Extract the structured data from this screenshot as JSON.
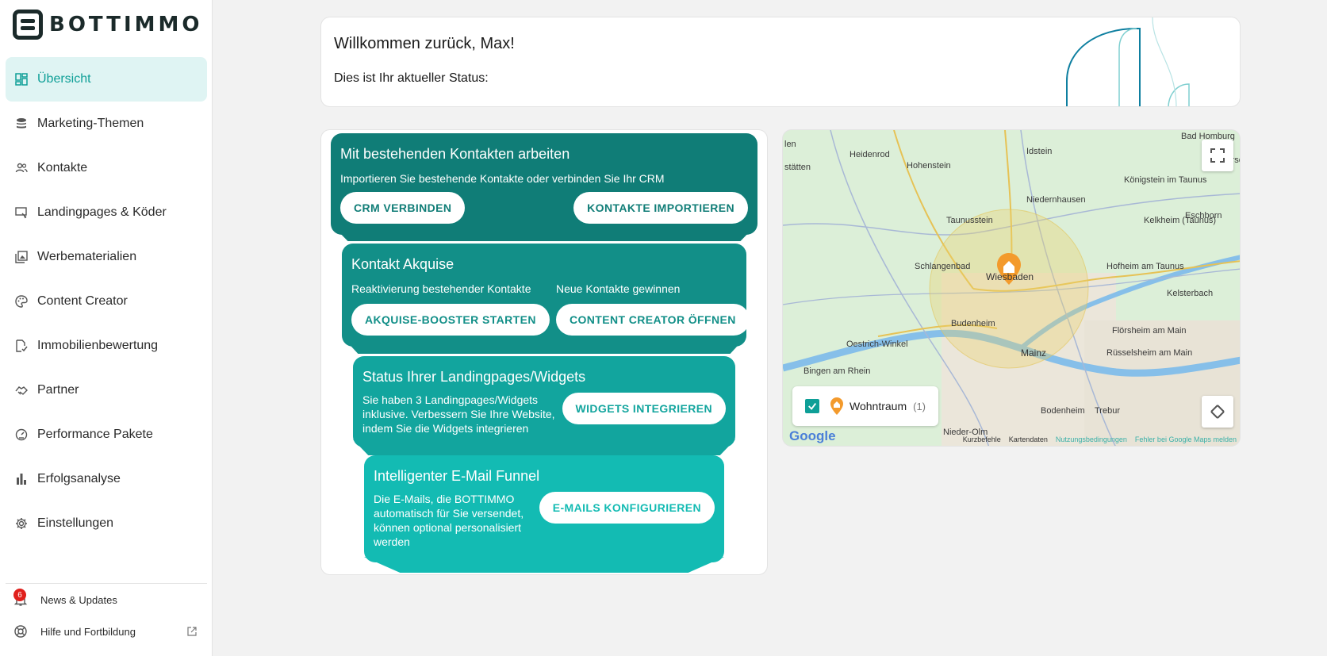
{
  "brand": {
    "name": "BOTTIMMO"
  },
  "sidebar": {
    "items": [
      {
        "label": "Übersicht",
        "icon": "dashboard-icon",
        "active": true
      },
      {
        "label": "Marketing-Themen",
        "icon": "database-icon"
      },
      {
        "label": "Kontakte",
        "icon": "people-icon"
      },
      {
        "label": "Landingpages & Köder",
        "icon": "landingpage-icon"
      },
      {
        "label": "Werbematerialien",
        "icon": "image-gallery-icon"
      },
      {
        "label": "Content Creator",
        "icon": "palette-icon"
      },
      {
        "label": "Immobilienbewertung",
        "icon": "file-check-icon"
      },
      {
        "label": "Partner",
        "icon": "handshake-icon"
      },
      {
        "label": "Performance Pakete",
        "icon": "speedometer-icon"
      },
      {
        "label": "Erfolgsanalyse",
        "icon": "bar-chart-icon"
      },
      {
        "label": "Einstellungen",
        "icon": "gear-icon"
      }
    ],
    "bottom": {
      "news_label": "News & Updates",
      "news_badge": "6",
      "help_label": "Hilfe und Fortbildung"
    }
  },
  "welcome": {
    "title": "Willkommen zurück, Max!",
    "subtitle": "Dies ist Ihr aktueller Status:"
  },
  "funnel": {
    "stage1": {
      "title": "Mit bestehenden Kontakten arbeiten",
      "text": "Importieren Sie bestehende Kontakte oder verbinden Sie Ihr CRM",
      "btn_left": "CRM VERBINDEN",
      "btn_right": "KONTAKTE IMPORTIEREN"
    },
    "stage2": {
      "title": "Kontakt Akquise",
      "text_left": "Reaktivierung bestehender Kontakte",
      "text_right": "Neue Kontakte gewinnen",
      "btn_left": "AKQUISE-BOOSTER STARTEN",
      "btn_right": "CONTENT CREATOR ÖFFNEN"
    },
    "stage3": {
      "title": "Status Ihrer Landingpages/Widgets",
      "text": "Sie haben 3 Landingpages/Widgets inklusive. Verbessern Sie Ihre Website, indem Sie die Widgets integrieren",
      "btn": "WIDGETS INTEGRIEREN"
    },
    "stage4": {
      "title": "Intelligenter E-Mail Funnel",
      "text": "Die E-Mails, die BOTTIMMO automatisch für Sie versendet, können optional personalisiert werden",
      "btn": "E-MAILS KONFIGURIEREN"
    }
  },
  "map": {
    "places": [
      "Heidenrod",
      "Idstein",
      "Hohenstein",
      "Niedernhausen",
      "Königstein im Taunus",
      "Taunusstein",
      "Kelkheim (Taunus)",
      "Eschborn",
      "Schlangenbad",
      "Wiesbaden",
      "Hofheim am Taunus",
      "Kelsterbach",
      "Budenheim",
      "Oestrich-Winkel",
      "Mainz",
      "Flörsheim am Main",
      "Rüsselsheim am Main",
      "Bingen am Rhein",
      "Bodenheim",
      "Trebur",
      "Nieder-Olm",
      "Bad Homburg",
      "Oberursel (Taunus)",
      "stätten",
      "len"
    ],
    "legend_label": "Wohntraum",
    "legend_count": "(1)",
    "footer": {
      "shortcuts": "Kurzbefehle",
      "data": "Kartendaten",
      "terms": "Nutzungsbedingungen",
      "report": "Fehler bei Google Maps melden"
    },
    "google": "Google"
  },
  "colors": {
    "accent": "#0e9f97",
    "stage1": "#107d77",
    "stage2": "#128f88",
    "stage3": "#12a59e",
    "stage4": "#13bbb3",
    "badge": "#e0201c"
  }
}
